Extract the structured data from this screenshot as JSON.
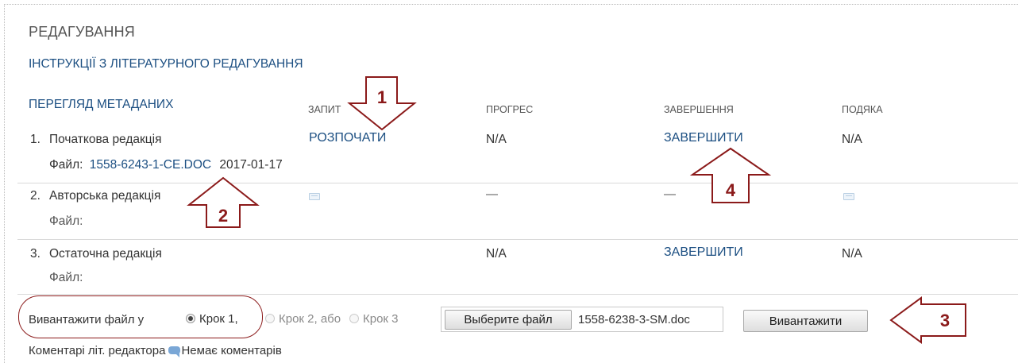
{
  "section_title": "РЕДАГУВАННЯ",
  "instructions_link": "ІНСТРУКЦІЇ З ЛІТЕРАТУРНОГО РЕДАГУВАННЯ",
  "metadata_link": "ПЕРЕГЛЯД МЕТАДАНИХ",
  "columns": {
    "request": "ЗАПИТ",
    "progress": "ПРОГРЕС",
    "completion": "ЗАВЕРШЕННЯ",
    "thanks": "ПОДЯКА"
  },
  "rows": [
    {
      "number": "1.",
      "name": "Початкова редакція",
      "file_label": "Файл:",
      "file_link": "1558-6243-1-CE.DOC",
      "file_date": "2017-01-17",
      "request": "РОЗПОЧАТИ",
      "progress": "N/A",
      "completion": "ЗАВЕРШИТИ",
      "thanks": "N/A"
    },
    {
      "number": "2.",
      "name": "Авторська редакція",
      "file_label": "Файл:",
      "request_icon": "mail-icon",
      "progress": "—",
      "completion": "—",
      "thanks_icon": "mail-icon"
    },
    {
      "number": "3.",
      "name": "Остаточна редакція",
      "file_label": "Файл:",
      "progress": "N/A",
      "completion": "ЗАВЕРШИТИ",
      "thanks": "N/A"
    }
  ],
  "upload": {
    "label": "Вивантажити файл у",
    "step1": "Крок 1,",
    "step2": "Крок 2, або",
    "step3": "Крок 3",
    "selected_step": "Крок 1",
    "choose_file_button": "Выберите файл",
    "chosen_file": "1558-6238-3-SM.doc",
    "upload_button": "Вивантажити"
  },
  "comments": {
    "label": "Коментарі літ. редактора",
    "value": "Немає коментарів"
  },
  "annotations": [
    "1",
    "2",
    "3",
    "4"
  ],
  "colors": {
    "link": "#1c4f82",
    "annotation": "#8b1a1a"
  }
}
